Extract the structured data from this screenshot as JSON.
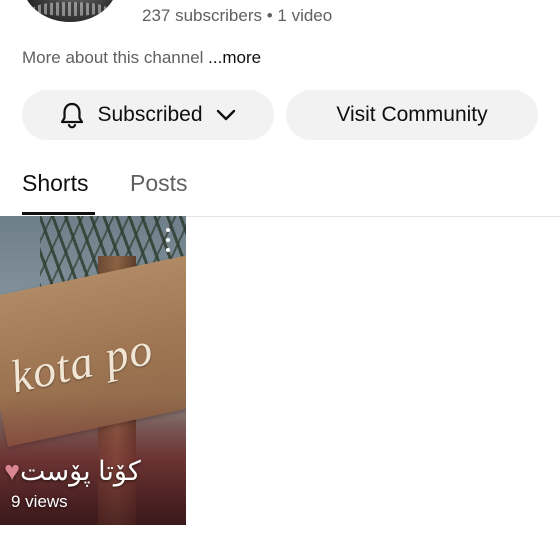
{
  "channel": {
    "stats": "237 subscribers • 1 video",
    "about_text": "More about this channel ",
    "about_more": "...more"
  },
  "buttons": {
    "subscribed_label": "Subscribed",
    "community_label": "Visit Community"
  },
  "tabs": [
    {
      "label": "Shorts",
      "selected": true
    },
    {
      "label": "Posts",
      "selected": false
    }
  ],
  "shorts": [
    {
      "sign_text": "kota po",
      "overlay_text": "کۆتا پۆست",
      "views": "9 views"
    }
  ],
  "icons": {
    "bell": "bell-icon",
    "chevron": "chevron-down-icon",
    "menu": "more-vert-icon"
  }
}
